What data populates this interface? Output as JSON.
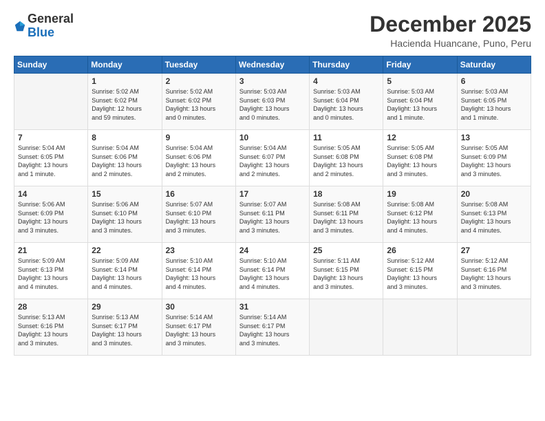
{
  "logo": {
    "general": "General",
    "blue": "Blue"
  },
  "title": "December 2025",
  "location": "Hacienda Huancane, Puno, Peru",
  "weekdays": [
    "Sunday",
    "Monday",
    "Tuesday",
    "Wednesday",
    "Thursday",
    "Friday",
    "Saturday"
  ],
  "weeks": [
    [
      {
        "day": "",
        "info": ""
      },
      {
        "day": "1",
        "info": "Sunrise: 5:02 AM\nSunset: 6:02 PM\nDaylight: 12 hours\nand 59 minutes."
      },
      {
        "day": "2",
        "info": "Sunrise: 5:02 AM\nSunset: 6:02 PM\nDaylight: 13 hours\nand 0 minutes."
      },
      {
        "day": "3",
        "info": "Sunrise: 5:03 AM\nSunset: 6:03 PM\nDaylight: 13 hours\nand 0 minutes."
      },
      {
        "day": "4",
        "info": "Sunrise: 5:03 AM\nSunset: 6:04 PM\nDaylight: 13 hours\nand 0 minutes."
      },
      {
        "day": "5",
        "info": "Sunrise: 5:03 AM\nSunset: 6:04 PM\nDaylight: 13 hours\nand 1 minute."
      },
      {
        "day": "6",
        "info": "Sunrise: 5:03 AM\nSunset: 6:05 PM\nDaylight: 13 hours\nand 1 minute."
      }
    ],
    [
      {
        "day": "7",
        "info": "Sunrise: 5:04 AM\nSunset: 6:05 PM\nDaylight: 13 hours\nand 1 minute."
      },
      {
        "day": "8",
        "info": "Sunrise: 5:04 AM\nSunset: 6:06 PM\nDaylight: 13 hours\nand 2 minutes."
      },
      {
        "day": "9",
        "info": "Sunrise: 5:04 AM\nSunset: 6:06 PM\nDaylight: 13 hours\nand 2 minutes."
      },
      {
        "day": "10",
        "info": "Sunrise: 5:04 AM\nSunset: 6:07 PM\nDaylight: 13 hours\nand 2 minutes."
      },
      {
        "day": "11",
        "info": "Sunrise: 5:05 AM\nSunset: 6:08 PM\nDaylight: 13 hours\nand 2 minutes."
      },
      {
        "day": "12",
        "info": "Sunrise: 5:05 AM\nSunset: 6:08 PM\nDaylight: 13 hours\nand 3 minutes."
      },
      {
        "day": "13",
        "info": "Sunrise: 5:05 AM\nSunset: 6:09 PM\nDaylight: 13 hours\nand 3 minutes."
      }
    ],
    [
      {
        "day": "14",
        "info": "Sunrise: 5:06 AM\nSunset: 6:09 PM\nDaylight: 13 hours\nand 3 minutes."
      },
      {
        "day": "15",
        "info": "Sunrise: 5:06 AM\nSunset: 6:10 PM\nDaylight: 13 hours\nand 3 minutes."
      },
      {
        "day": "16",
        "info": "Sunrise: 5:07 AM\nSunset: 6:10 PM\nDaylight: 13 hours\nand 3 minutes."
      },
      {
        "day": "17",
        "info": "Sunrise: 5:07 AM\nSunset: 6:11 PM\nDaylight: 13 hours\nand 3 minutes."
      },
      {
        "day": "18",
        "info": "Sunrise: 5:08 AM\nSunset: 6:11 PM\nDaylight: 13 hours\nand 3 minutes."
      },
      {
        "day": "19",
        "info": "Sunrise: 5:08 AM\nSunset: 6:12 PM\nDaylight: 13 hours\nand 4 minutes."
      },
      {
        "day": "20",
        "info": "Sunrise: 5:08 AM\nSunset: 6:13 PM\nDaylight: 13 hours\nand 4 minutes."
      }
    ],
    [
      {
        "day": "21",
        "info": "Sunrise: 5:09 AM\nSunset: 6:13 PM\nDaylight: 13 hours\nand 4 minutes."
      },
      {
        "day": "22",
        "info": "Sunrise: 5:09 AM\nSunset: 6:14 PM\nDaylight: 13 hours\nand 4 minutes."
      },
      {
        "day": "23",
        "info": "Sunrise: 5:10 AM\nSunset: 6:14 PM\nDaylight: 13 hours\nand 4 minutes."
      },
      {
        "day": "24",
        "info": "Sunrise: 5:10 AM\nSunset: 6:14 PM\nDaylight: 13 hours\nand 4 minutes."
      },
      {
        "day": "25",
        "info": "Sunrise: 5:11 AM\nSunset: 6:15 PM\nDaylight: 13 hours\nand 3 minutes."
      },
      {
        "day": "26",
        "info": "Sunrise: 5:12 AM\nSunset: 6:15 PM\nDaylight: 13 hours\nand 3 minutes."
      },
      {
        "day": "27",
        "info": "Sunrise: 5:12 AM\nSunset: 6:16 PM\nDaylight: 13 hours\nand 3 minutes."
      }
    ],
    [
      {
        "day": "28",
        "info": "Sunrise: 5:13 AM\nSunset: 6:16 PM\nDaylight: 13 hours\nand 3 minutes."
      },
      {
        "day": "29",
        "info": "Sunrise: 5:13 AM\nSunset: 6:17 PM\nDaylight: 13 hours\nand 3 minutes."
      },
      {
        "day": "30",
        "info": "Sunrise: 5:14 AM\nSunset: 6:17 PM\nDaylight: 13 hours\nand 3 minutes."
      },
      {
        "day": "31",
        "info": "Sunrise: 5:14 AM\nSunset: 6:17 PM\nDaylight: 13 hours\nand 3 minutes."
      },
      {
        "day": "",
        "info": ""
      },
      {
        "day": "",
        "info": ""
      },
      {
        "day": "",
        "info": ""
      }
    ]
  ],
  "colors": {
    "header_bg": "#2a6db5",
    "accent": "#1a6fba"
  }
}
